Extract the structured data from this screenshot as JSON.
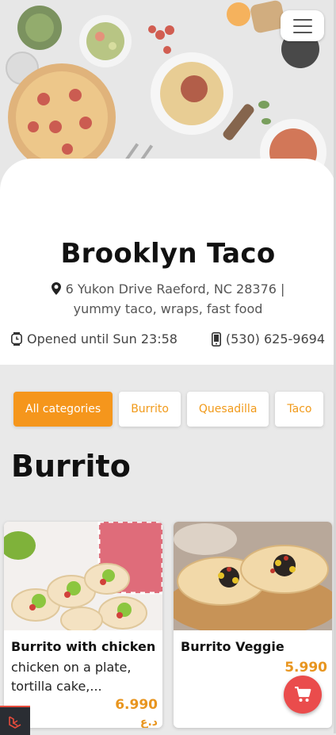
{
  "header": {
    "menu_icon": "hamburger-icon"
  },
  "restaurant": {
    "name": "Brooklyn Taco",
    "address": "6 Yukon Drive Raeford, NC 28376 |",
    "description": "yummy taco, wraps, fast food",
    "hours": "Opened until Sun 23:58",
    "phone": "(530) 625-9694"
  },
  "categories": [
    {
      "label": "All categories",
      "active": true
    },
    {
      "label": "Burrito",
      "active": false
    },
    {
      "label": "Quesadilla",
      "active": false
    },
    {
      "label": "Taco",
      "active": false
    }
  ],
  "section": {
    "title": "Burrito"
  },
  "products": [
    {
      "name": "Burrito with chicken",
      "description": "chicken on a plate, tortilla cake,...",
      "price": "6.990",
      "currency": "د.ع"
    },
    {
      "name": "Burrito Veggie",
      "description": "",
      "price": "5.990"
    }
  ],
  "cart": {
    "icon": "cart-icon"
  },
  "colors": {
    "accent": "#f5961c",
    "cart": "#ea4c4c"
  }
}
